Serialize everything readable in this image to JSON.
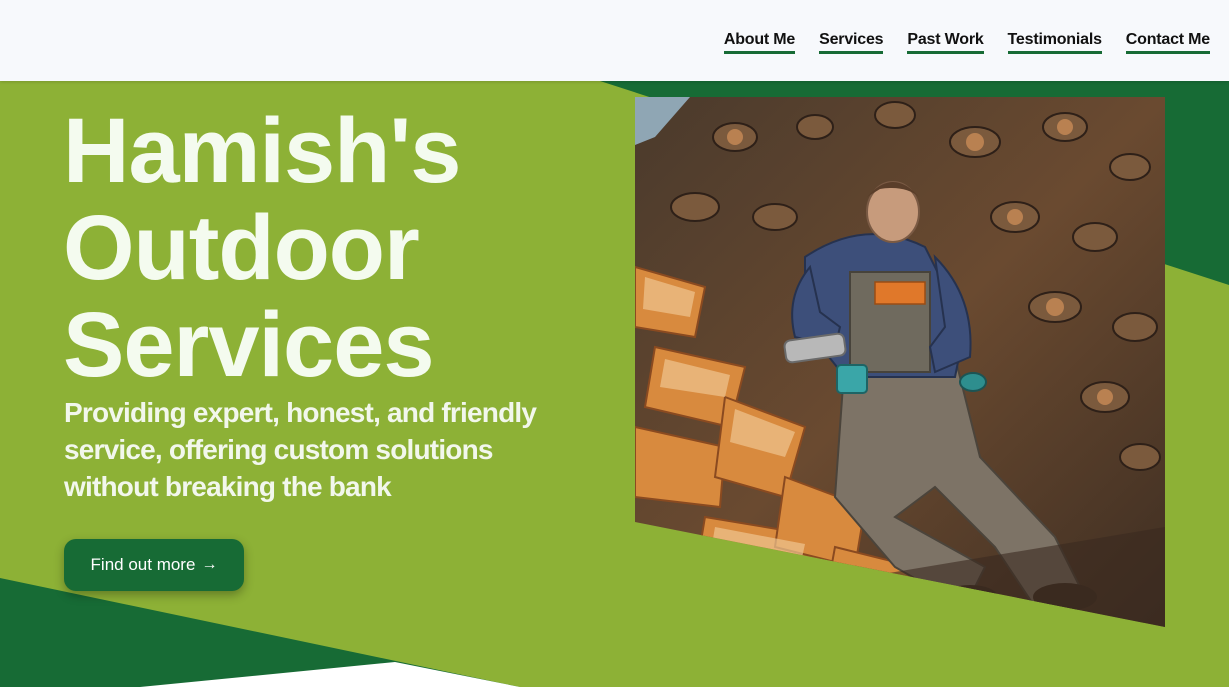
{
  "nav": {
    "items": [
      "About Me",
      "Services",
      "Past Work",
      "Testimonials",
      "Contact Me"
    ]
  },
  "hero": {
    "title_lines": [
      "Hamish's",
      "Outdoor",
      "Services"
    ],
    "subtitle": "Providing expert, honest, and friendly service, offering custom solutions without breaking the bank",
    "cta_label": "Find out more",
    "cta_arrow": "→"
  },
  "colors": {
    "primary_green": "#8db136",
    "dark_green": "#176b35",
    "header_bg": "#f7f9fc",
    "text_light": "#f4fbef"
  },
  "image": {
    "subject": "man-pouring-drink-on-woodpile-photo"
  }
}
